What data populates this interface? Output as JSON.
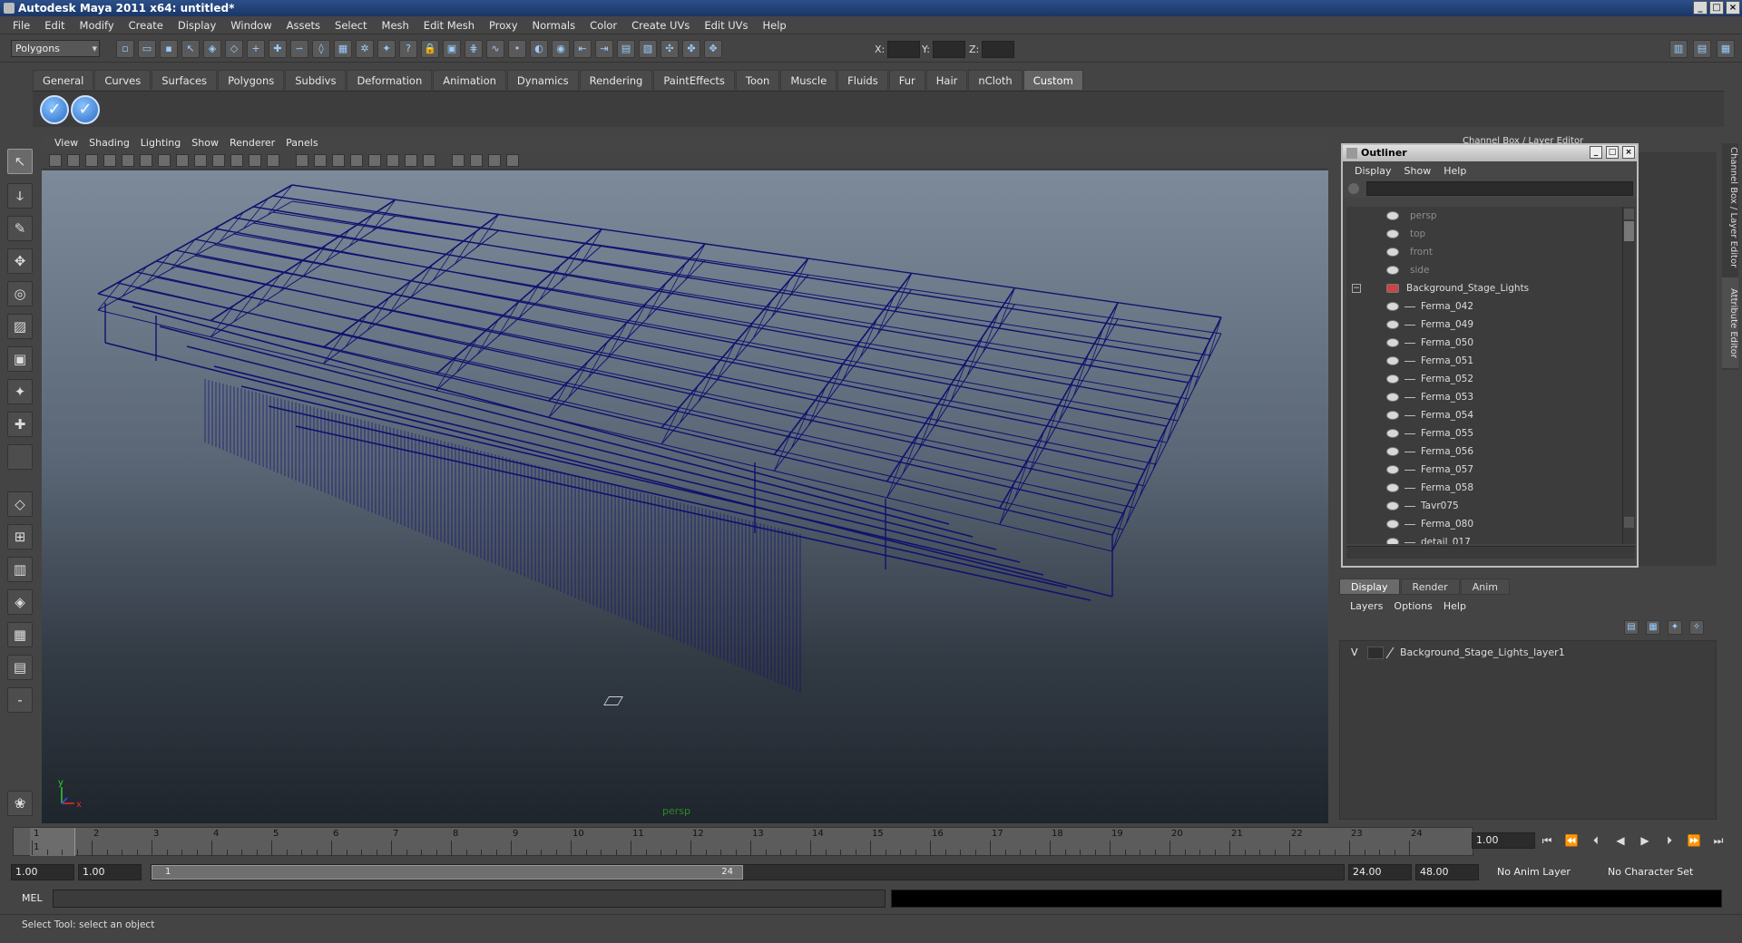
{
  "window": {
    "title": "Autodesk Maya 2011 x64: untitled*"
  },
  "menubar": [
    "File",
    "Edit",
    "Modify",
    "Create",
    "Display",
    "Window",
    "Assets",
    "Select",
    "Mesh",
    "Edit Mesh",
    "Proxy",
    "Normals",
    "Color",
    "Create UVs",
    "Edit UVs",
    "Help"
  ],
  "statusline": {
    "mode": "Polygons",
    "x_label": "X:",
    "y_label": "Y:",
    "z_label": "Z:"
  },
  "shelf_tabs": [
    "General",
    "Curves",
    "Surfaces",
    "Polygons",
    "Subdivs",
    "Deformation",
    "Animation",
    "Dynamics",
    "Rendering",
    "PaintEffects",
    "Toon",
    "Muscle",
    "Fluids",
    "Fur",
    "Hair",
    "nCloth",
    "Custom"
  ],
  "shelf_active": "Custom",
  "viewport": {
    "menu": [
      "View",
      "Shading",
      "Lighting",
      "Show",
      "Renderer",
      "Panels"
    ],
    "camera": "persp",
    "axis_y": "y",
    "axis_x": "x",
    "wire_color": "#10116e"
  },
  "outliner": {
    "title": "Outliner",
    "menu": [
      "Display",
      "Show",
      "Help"
    ],
    "items": [
      {
        "label": "persp",
        "dim": true,
        "group": false
      },
      {
        "label": "top",
        "dim": true,
        "group": false
      },
      {
        "label": "front",
        "dim": true,
        "group": false
      },
      {
        "label": "side",
        "dim": true,
        "group": false
      },
      {
        "label": "Background_Stage_Lights",
        "dim": false,
        "group": true
      },
      {
        "label": "Ferma_042",
        "dim": false,
        "group": false
      },
      {
        "label": "Ferma_049",
        "dim": false,
        "group": false
      },
      {
        "label": "Ferma_050",
        "dim": false,
        "group": false
      },
      {
        "label": "Ferma_051",
        "dim": false,
        "group": false
      },
      {
        "label": "Ferma_052",
        "dim": false,
        "group": false
      },
      {
        "label": "Ferma_053",
        "dim": false,
        "group": false
      },
      {
        "label": "Ferma_054",
        "dim": false,
        "group": false
      },
      {
        "label": "Ferma_055",
        "dim": false,
        "group": false
      },
      {
        "label": "Ferma_056",
        "dim": false,
        "group": false
      },
      {
        "label": "Ferma_057",
        "dim": false,
        "group": false
      },
      {
        "label": "Ferma_058",
        "dim": false,
        "group": false
      },
      {
        "label": "Tavr075",
        "dim": false,
        "group": false
      },
      {
        "label": "Ferma_080",
        "dim": false,
        "group": false
      },
      {
        "label": "detail_017",
        "dim": false,
        "group": false
      }
    ]
  },
  "channel_box_title": "Channel Box / Layer Editor",
  "side_tabs": {
    "channel": "Channel Box / Layer Editor",
    "attribute": "Attribute Editor"
  },
  "layer_editor": {
    "tabs": [
      "Display",
      "Render",
      "Anim"
    ],
    "menu": [
      "Layers",
      "Options",
      "Help"
    ],
    "layer": {
      "visible": "V",
      "name": "Background_Stage_Lights_layer1"
    }
  },
  "timeline": {
    "ticks": [
      "1",
      "2",
      "3",
      "4",
      "5",
      "6",
      "7",
      "8",
      "9",
      "10",
      "11",
      "12",
      "13",
      "14",
      "15",
      "16",
      "17",
      "18",
      "19",
      "20",
      "21",
      "22",
      "23",
      "24"
    ],
    "current_marker": "1",
    "current_frame": "1.00"
  },
  "range": {
    "start": "1.00",
    "playback_start": "1.00",
    "slider_start": "1",
    "slider_end": "24",
    "playback_end": "24.00",
    "end": "48.00",
    "anim_layer": "No Anim Layer",
    "character_set": "No Character Set"
  },
  "command": {
    "label": "MEL"
  },
  "help_line": "Select Tool: select an object"
}
